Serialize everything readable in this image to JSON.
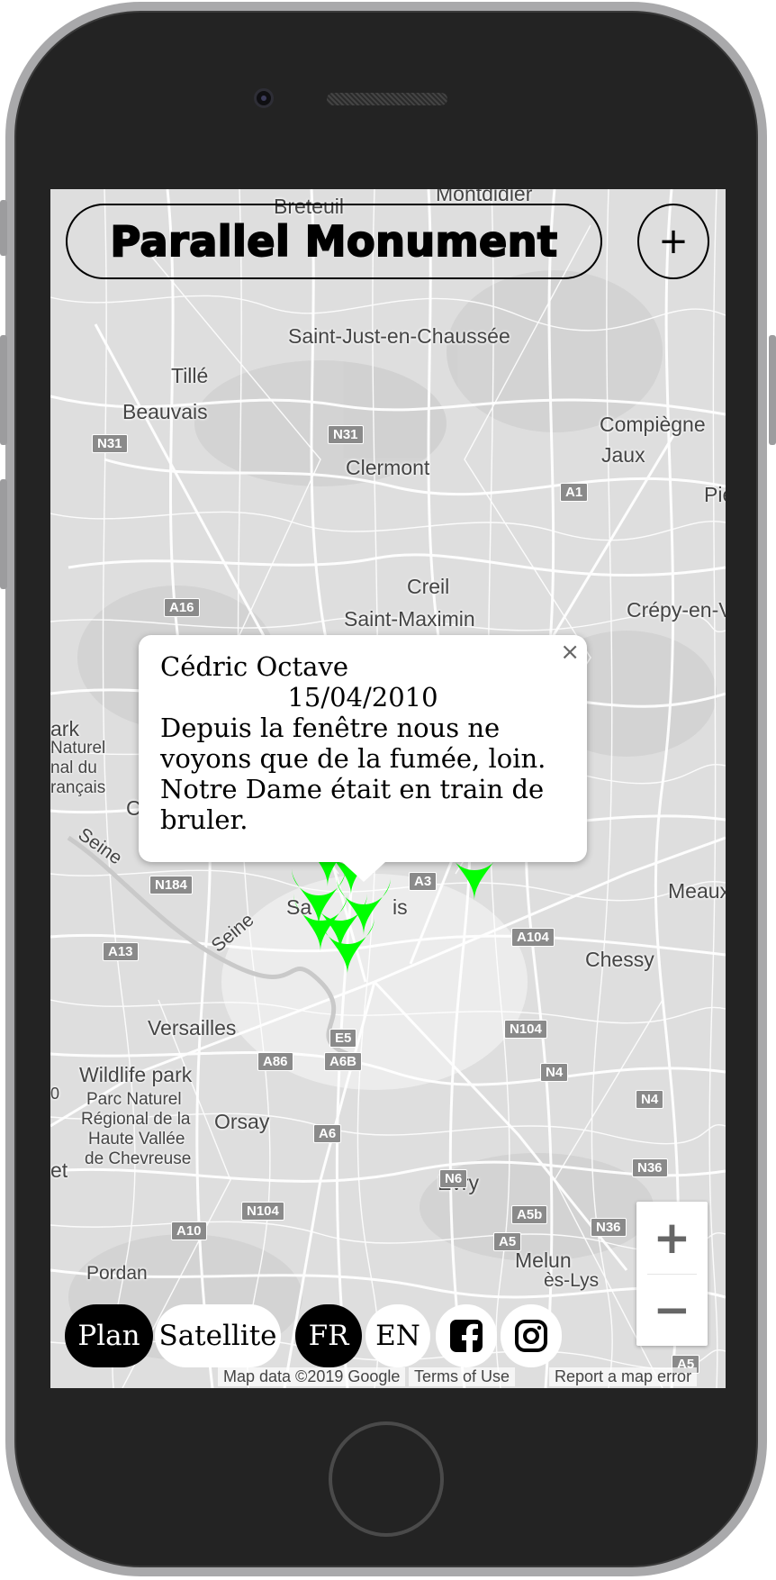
{
  "app": {
    "title": "Parallel Monument",
    "add_label": "+"
  },
  "map": {
    "places": [
      {
        "name": "Montdidier"
      },
      {
        "name": "Breteuil"
      },
      {
        "name": "Saint-Just-en-Chaussée"
      },
      {
        "name": "Tillé"
      },
      {
        "name": "Beauvais"
      },
      {
        "name": "Compiègne"
      },
      {
        "name": "Jaux"
      },
      {
        "name": "Clermont"
      },
      {
        "name": "Pie"
      },
      {
        "name": "Creil"
      },
      {
        "name": "Saint-Maximin"
      },
      {
        "name": "Crépy-en-V"
      },
      {
        "name": "ark"
      },
      {
        "name": "Naturel"
      },
      {
        "name": "nal du"
      },
      {
        "name": "rançais"
      },
      {
        "name": "C"
      },
      {
        "name": "Seine"
      },
      {
        "name": "Sa"
      },
      {
        "name": "is"
      },
      {
        "name": "Meaux"
      },
      {
        "name": "Seine"
      },
      {
        "name": "Chessy"
      },
      {
        "name": "Versailles"
      },
      {
        "name": "Wildlife park"
      },
      {
        "name": "Parc Naturel"
      },
      {
        "name": "Régional de la"
      },
      {
        "name": "Haute Vallée"
      },
      {
        "name": "de Chevreuse"
      },
      {
        "name": "Orsay"
      },
      {
        "name": "et"
      },
      {
        "name": "Évry"
      },
      {
        "name": "Melun"
      },
      {
        "name": "ès-Lys"
      },
      {
        "name": "Pordan"
      },
      {
        "name": "0"
      }
    ],
    "roads": [
      "N31",
      "N31",
      "A1",
      "A16",
      "N184",
      "A13",
      "A3",
      "A104",
      "E5",
      "A6B",
      "A86",
      "N104",
      "N4",
      "N4",
      "A6",
      "N6",
      "N36",
      "N104",
      "A10",
      "A5b",
      "A5",
      "N36",
      "A5"
    ],
    "marker_color": "#00ff00",
    "attribution": {
      "map_data": "Map data ©2019 Google",
      "terms": "Terms of Use",
      "report": "Report a map error"
    }
  },
  "popup": {
    "author": "Cédric Octave",
    "date": "15/04/2010",
    "text": "Depuis la fenêtre nous ne voyons que de la fumée, loin. Notre Dame était en train de bruler.",
    "close": "×"
  },
  "zoom": {
    "in": "+",
    "out": "−"
  },
  "bottom_bar": {
    "map_types": [
      {
        "label": "Plan",
        "active": true
      },
      {
        "label": "Satellite",
        "active": false
      }
    ],
    "languages": [
      {
        "label": "FR",
        "active": true
      },
      {
        "label": "EN",
        "active": false
      }
    ],
    "social": [
      "facebook-icon",
      "instagram-icon"
    ]
  },
  "colors": {
    "accent": "#00ff00",
    "text": "#000000",
    "active_pill": "#000000"
  }
}
